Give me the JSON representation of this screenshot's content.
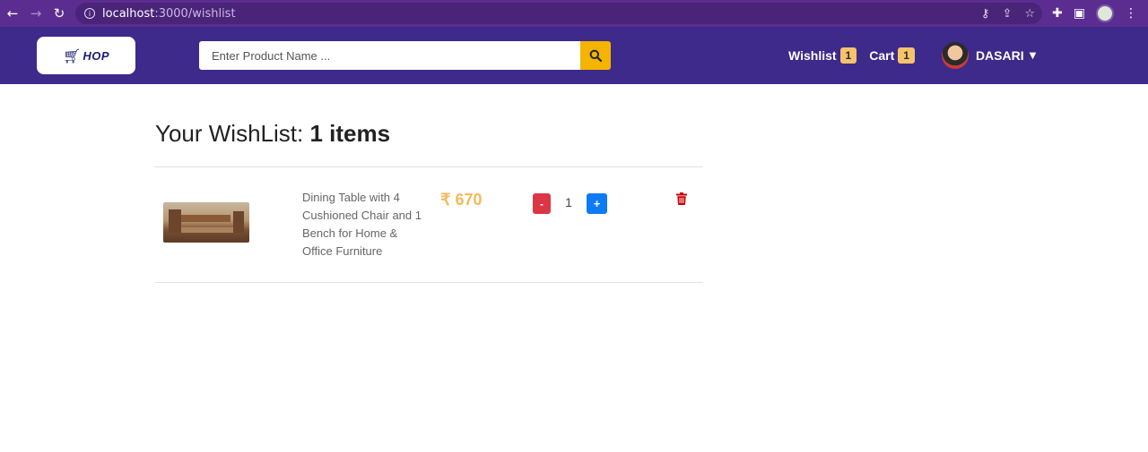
{
  "browser": {
    "url_host": "localhost",
    "url_path": ":3000/wishlist"
  },
  "header": {
    "logo_text": "HOP",
    "search_placeholder": "Enter Product Name ...",
    "wishlist_label": "Wishlist",
    "wishlist_count": "1",
    "cart_label": "Cart",
    "cart_count": "1",
    "user_name": "DASARI"
  },
  "main": {
    "title_prefix": "Your WishList: ",
    "title_count": "1 items",
    "items": [
      {
        "name": "Dining Table with 4 Cushioned Chair and 1 Bench for Home & Office Furniture",
        "price": "₹ 670",
        "quantity": "1",
        "minus_label": "-",
        "plus_label": "+"
      }
    ]
  },
  "colors": {
    "header_bg": "#3d2a8a",
    "search_btn": "#f4b400",
    "price": "#f5b95a",
    "minus_btn": "#dc3545",
    "plus_btn": "#0d7bf4",
    "trash": "#cc0000"
  },
  "icons": {
    "search": "search-icon",
    "trash": "trash-icon",
    "caret": "caret-down-icon"
  }
}
